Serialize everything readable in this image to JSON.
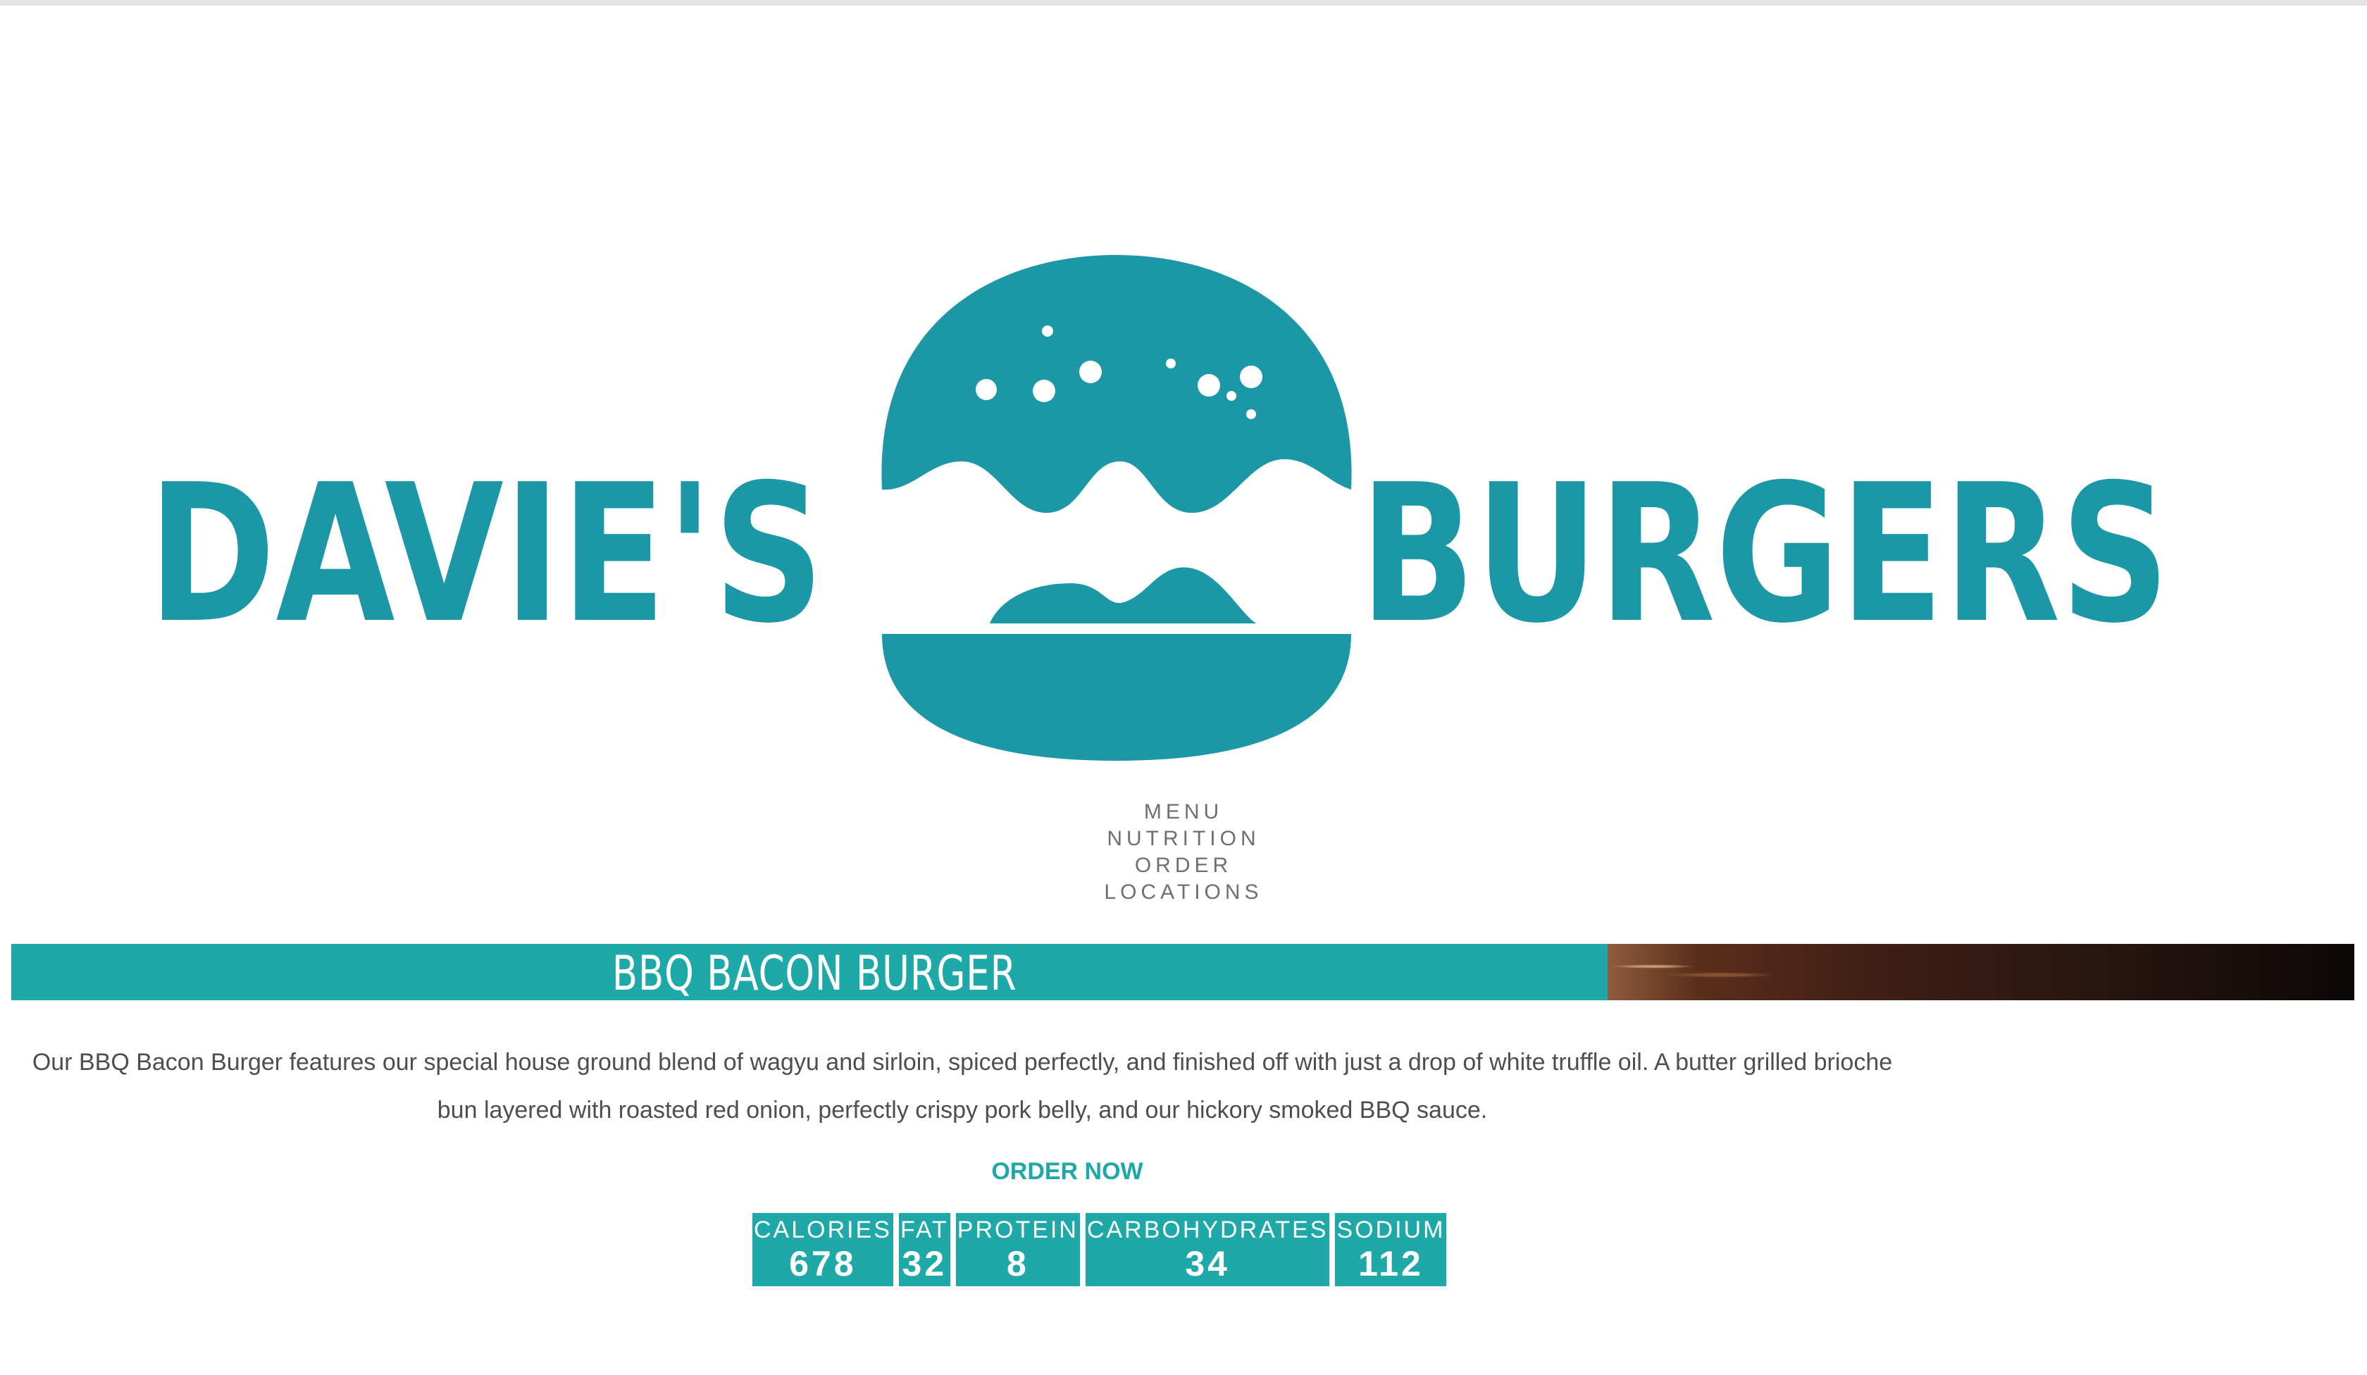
{
  "brand": {
    "name_left": "DAVIE'S",
    "name_right": "BURGERS",
    "color": "#1c97a6"
  },
  "nav": {
    "items": [
      {
        "label": "MENU"
      },
      {
        "label": "NUTRITION"
      },
      {
        "label": "ORDER"
      },
      {
        "label": "LOCATIONS"
      }
    ]
  },
  "product": {
    "title": "BBQ BACON BURGER",
    "description": "Our BBQ Bacon Burger features our special house ground blend of wagyu and sirloin, spiced perfectly, and finished off with just a drop of white truffle oil. A butter grilled brioche bun layered with roasted red onion, perfectly crispy pork belly, and our hickory smoked BBQ sauce.",
    "order_label": "ORDER NOW"
  },
  "nutrition": [
    {
      "label": "CALORIES",
      "value": "678"
    },
    {
      "label": "FAT",
      "value": "32"
    },
    {
      "label": "PROTEIN",
      "value": "8"
    },
    {
      "label": "CARBOHYDRATES",
      "value": "34"
    },
    {
      "label": "SODIUM",
      "value": "112"
    }
  ],
  "colors": {
    "accent": "#1fa8a8",
    "logo": "#1c97a6",
    "text": "#4e4e4e",
    "nav_text": "#6f6f6f"
  }
}
